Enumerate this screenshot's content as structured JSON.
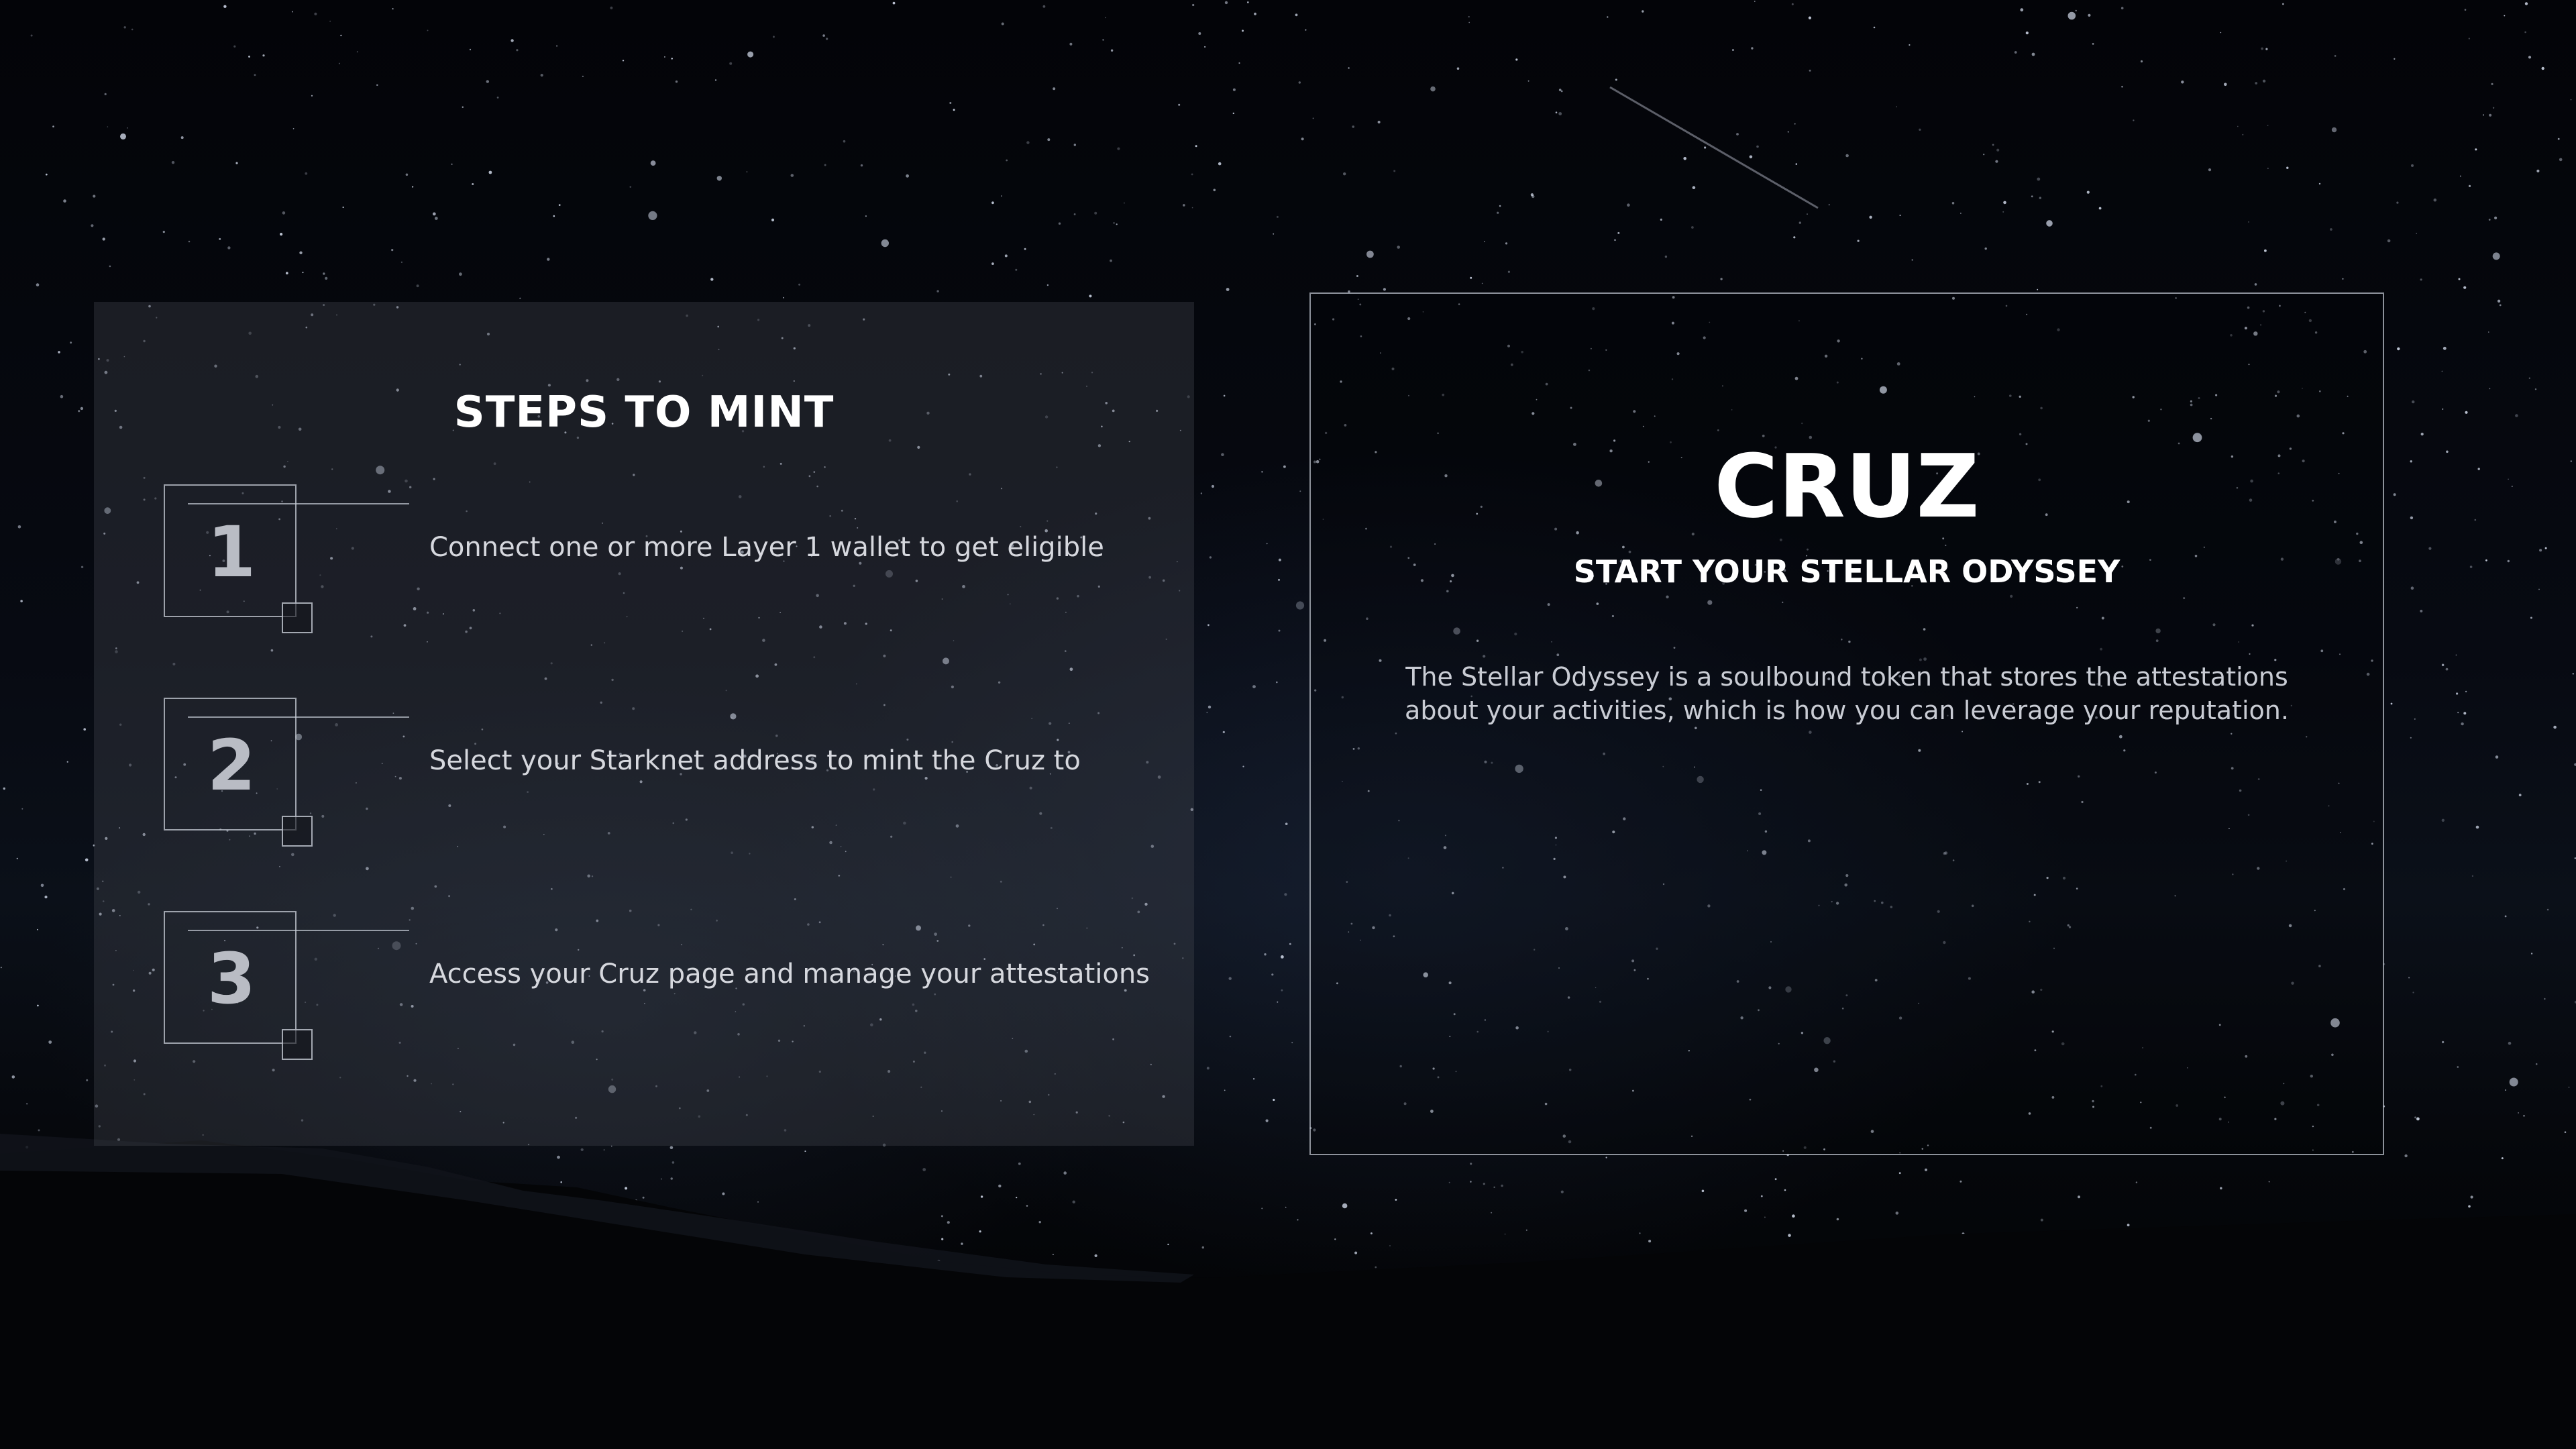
{
  "steps_panel": {
    "title": "STEPS TO MINT",
    "steps": [
      {
        "number": "1",
        "text": "Connect one or more Layer 1 wallet to get eligible"
      },
      {
        "number": "2",
        "text": "Select your Starknet address to mint the Cruz to"
      },
      {
        "number": "3",
        "text": "Access your Cruz page and manage your attestations"
      }
    ]
  },
  "cruz_panel": {
    "title": "CRUZ",
    "subtitle": "START YOUR STELLAR ODYSSEY",
    "description": "The Stellar Odyssey is a soulbound token that stores the attestations about your activities, which is how you can leverage your reputation."
  },
  "colors": {
    "background": "#05060a",
    "panel_fill": "#2a2c33",
    "border": "#c8cdd7",
    "title_text": "#ffffff",
    "body_text": "#d6d8de"
  }
}
